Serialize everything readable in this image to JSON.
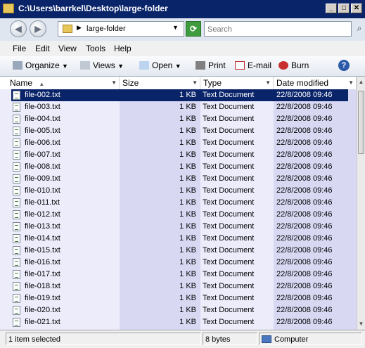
{
  "window": {
    "title": "C:\\Users\\barrkel\\Desktop\\large-folder"
  },
  "address": {
    "path": "large-folder",
    "search_placeholder": "Search"
  },
  "menu": [
    "File",
    "Edit",
    "View",
    "Tools",
    "Help"
  ],
  "toolbar": {
    "organize": "Organize",
    "views": "Views",
    "open": "Open",
    "print": "Print",
    "email": "E-mail",
    "burn": "Burn",
    "help": "?"
  },
  "columns": {
    "name": "Name",
    "size": "Size",
    "type": "Type",
    "date": "Date modified"
  },
  "files": [
    {
      "name": "file-002.txt",
      "size": "1 KB",
      "type": "Text Document",
      "date": "22/8/2008 09:46",
      "selected": true
    },
    {
      "name": "file-003.txt",
      "size": "1 KB",
      "type": "Text Document",
      "date": "22/8/2008 09:46"
    },
    {
      "name": "file-004.txt",
      "size": "1 KB",
      "type": "Text Document",
      "date": "22/8/2008 09:46"
    },
    {
      "name": "file-005.txt",
      "size": "1 KB",
      "type": "Text Document",
      "date": "22/8/2008 09:46"
    },
    {
      "name": "file-006.txt",
      "size": "1 KB",
      "type": "Text Document",
      "date": "22/8/2008 09:46"
    },
    {
      "name": "file-007.txt",
      "size": "1 KB",
      "type": "Text Document",
      "date": "22/8/2008 09:46"
    },
    {
      "name": "file-008.txt",
      "size": "1 KB",
      "type": "Text Document",
      "date": "22/8/2008 09:46"
    },
    {
      "name": "file-009.txt",
      "size": "1 KB",
      "type": "Text Document",
      "date": "22/8/2008 09:46"
    },
    {
      "name": "file-010.txt",
      "size": "1 KB",
      "type": "Text Document",
      "date": "22/8/2008 09:46"
    },
    {
      "name": "file-011.txt",
      "size": "1 KB",
      "type": "Text Document",
      "date": "22/8/2008 09:46"
    },
    {
      "name": "file-012.txt",
      "size": "1 KB",
      "type": "Text Document",
      "date": "22/8/2008 09:46"
    },
    {
      "name": "file-013.txt",
      "size": "1 KB",
      "type": "Text Document",
      "date": "22/8/2008 09:46"
    },
    {
      "name": "file-014.txt",
      "size": "1 KB",
      "type": "Text Document",
      "date": "22/8/2008 09:46"
    },
    {
      "name": "file-015.txt",
      "size": "1 KB",
      "type": "Text Document",
      "date": "22/8/2008 09:46"
    },
    {
      "name": "file-016.txt",
      "size": "1 KB",
      "type": "Text Document",
      "date": "22/8/2008 09:46"
    },
    {
      "name": "file-017.txt",
      "size": "1 KB",
      "type": "Text Document",
      "date": "22/8/2008 09:46"
    },
    {
      "name": "file-018.txt",
      "size": "1 KB",
      "type": "Text Document",
      "date": "22/8/2008 09:46"
    },
    {
      "name": "file-019.txt",
      "size": "1 KB",
      "type": "Text Document",
      "date": "22/8/2008 09:46"
    },
    {
      "name": "file-020.txt",
      "size": "1 KB",
      "type": "Text Document",
      "date": "22/8/2008 09:46"
    },
    {
      "name": "file-021.txt",
      "size": "1 KB",
      "type": "Text Document",
      "date": "22/8/2008 09:46"
    }
  ],
  "status": {
    "selection": "1 item selected",
    "size": "8 bytes",
    "location": "Computer"
  }
}
